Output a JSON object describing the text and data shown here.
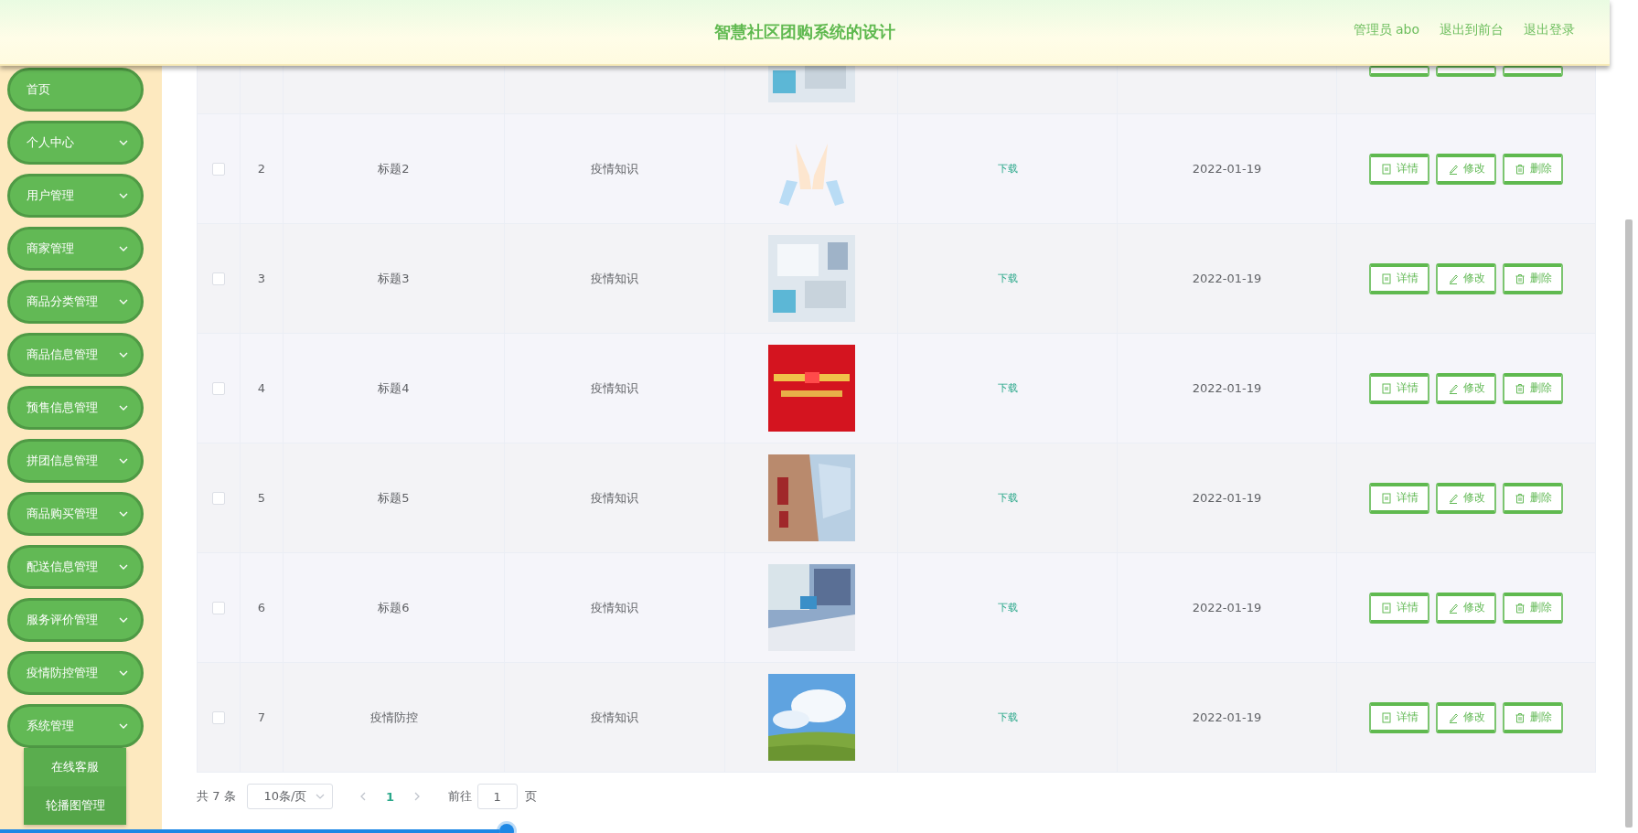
{
  "header": {
    "title": "智慧社区团购系统的设计",
    "links": [
      "管理员 abo",
      "退出到前台",
      "退出登录"
    ]
  },
  "sidebar": {
    "items": [
      {
        "label": "首页",
        "kind": "link"
      },
      {
        "label": "个人中心",
        "kind": "submenu"
      },
      {
        "label": "用户管理",
        "kind": "submenu"
      },
      {
        "label": "商家管理",
        "kind": "submenu"
      },
      {
        "label": "商品分类管理",
        "kind": "submenu"
      },
      {
        "label": "商品信息管理",
        "kind": "submenu"
      },
      {
        "label": "预售信息管理",
        "kind": "submenu"
      },
      {
        "label": "拼团信息管理",
        "kind": "submenu"
      },
      {
        "label": "商品购买管理",
        "kind": "submenu"
      },
      {
        "label": "配送信息管理",
        "kind": "submenu"
      },
      {
        "label": "服务评价管理",
        "kind": "submenu"
      },
      {
        "label": "疫情防控管理",
        "kind": "submenu"
      },
      {
        "label": "系统管理",
        "kind": "submenu",
        "children": [
          {
            "label": "在线客服"
          },
          {
            "label": "轮播图管理"
          }
        ]
      }
    ]
  },
  "table": {
    "rows": [
      {
        "checked": false,
        "index": "2",
        "title": "标题2",
        "category": "疫情知识",
        "file": "下载",
        "date": "2022-01-19",
        "actions": [
          {
            "kind": "detail",
            "label": "详情"
          },
          {
            "kind": "edit",
            "label": "修改"
          },
          {
            "kind": "delete",
            "label": "删除"
          }
        ]
      },
      {
        "checked": false,
        "index": "3",
        "title": "标题3",
        "category": "疫情知识",
        "file": "下载",
        "date": "2022-01-19",
        "actions": [
          {
            "kind": "detail",
            "label": "详情"
          },
          {
            "kind": "edit",
            "label": "修改"
          },
          {
            "kind": "delete",
            "label": "删除"
          }
        ]
      },
      {
        "checked": false,
        "index": "4",
        "title": "标题4",
        "category": "疫情知识",
        "file": "下载",
        "date": "2022-01-19",
        "actions": [
          {
            "kind": "detail",
            "label": "详情"
          },
          {
            "kind": "edit",
            "label": "修改"
          },
          {
            "kind": "delete",
            "label": "删除"
          }
        ]
      },
      {
        "checked": false,
        "index": "5",
        "title": "标题5",
        "category": "疫情知识",
        "file": "下载",
        "date": "2022-01-19",
        "actions": [
          {
            "kind": "detail",
            "label": "详情"
          },
          {
            "kind": "edit",
            "label": "修改"
          },
          {
            "kind": "delete",
            "label": "删除"
          }
        ]
      },
      {
        "checked": false,
        "index": "6",
        "title": "标题6",
        "category": "疫情知识",
        "file": "下载",
        "date": "2022-01-19",
        "actions": [
          {
            "kind": "detail",
            "label": "详情"
          },
          {
            "kind": "edit",
            "label": "修改"
          },
          {
            "kind": "delete",
            "label": "删除"
          }
        ]
      },
      {
        "checked": false,
        "index": "7",
        "title": "疫情防控",
        "category": "疫情知识",
        "file": "下载",
        "date": "2022-01-19",
        "actions": [
          {
            "kind": "detail",
            "label": "详情"
          },
          {
            "kind": "edit",
            "label": "修改"
          },
          {
            "kind": "delete",
            "label": "删除"
          }
        ]
      }
    ]
  },
  "pagination": {
    "total": "共 7 条",
    "page_size": "10条/页",
    "pages": [
      {
        "label": "1",
        "selected": true
      }
    ],
    "goto_label": "前往",
    "goto_value": "1",
    "page_suffix": "页"
  },
  "playback_bar": {
    "level": 0.31
  }
}
